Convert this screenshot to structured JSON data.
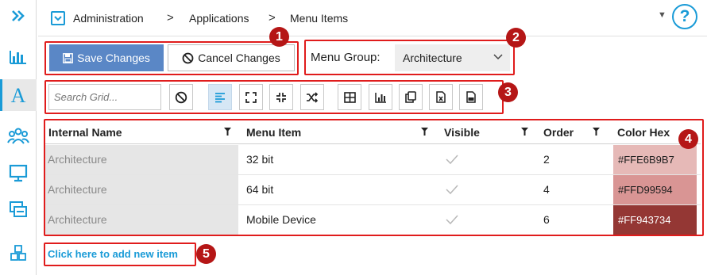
{
  "breadcrumb": {
    "items": [
      "Administration",
      "Applications",
      "Menu Items"
    ]
  },
  "toolbar": {
    "save_label": "Save Changes",
    "cancel_label": "Cancel Changes",
    "menu_group_label": "Menu Group:",
    "menu_group_value": "Architecture",
    "search_placeholder": "Search Grid..."
  },
  "grid": {
    "columns": [
      "Internal Name",
      "Menu Item",
      "Visible",
      "Order",
      "Color Hex"
    ],
    "rows": [
      {
        "internal_name": "Architecture",
        "menu_item": "32 bit",
        "visible": true,
        "order": "2",
        "color_hex": "#FFE6B9B7"
      },
      {
        "internal_name": "Architecture",
        "menu_item": "64 bit",
        "visible": true,
        "order": "4",
        "color_hex": "#FFD99594"
      },
      {
        "internal_name": "Architecture",
        "menu_item": "Mobile Device",
        "visible": true,
        "order": "6",
        "color_hex": "#FF943734"
      }
    ],
    "add_label": "Click here to add new item"
  },
  "annotations": [
    "1",
    "2",
    "3",
    "4",
    "5"
  ],
  "colors": {
    "accent": "#1a9bd7",
    "save": "#5a87c6",
    "highlight": "#e01c1c",
    "badge": "#b51616",
    "row1": "#e6b9b7",
    "row2": "#d99594",
    "row3": "#943734"
  },
  "icons": {
    "rail": [
      "double-chevron-right-icon",
      "bar-chart-icon",
      "letter-a-icon",
      "users-icon",
      "monitor-icon",
      "screens-icon",
      "cubes-icon"
    ],
    "toolbar": [
      "clear-icon",
      "align-left-icon",
      "expand-icon",
      "collapse-icon",
      "shuffle-icon",
      "grid-icon",
      "chart-icon",
      "copy-icon",
      "excel-icon",
      "pdf-icon"
    ]
  }
}
